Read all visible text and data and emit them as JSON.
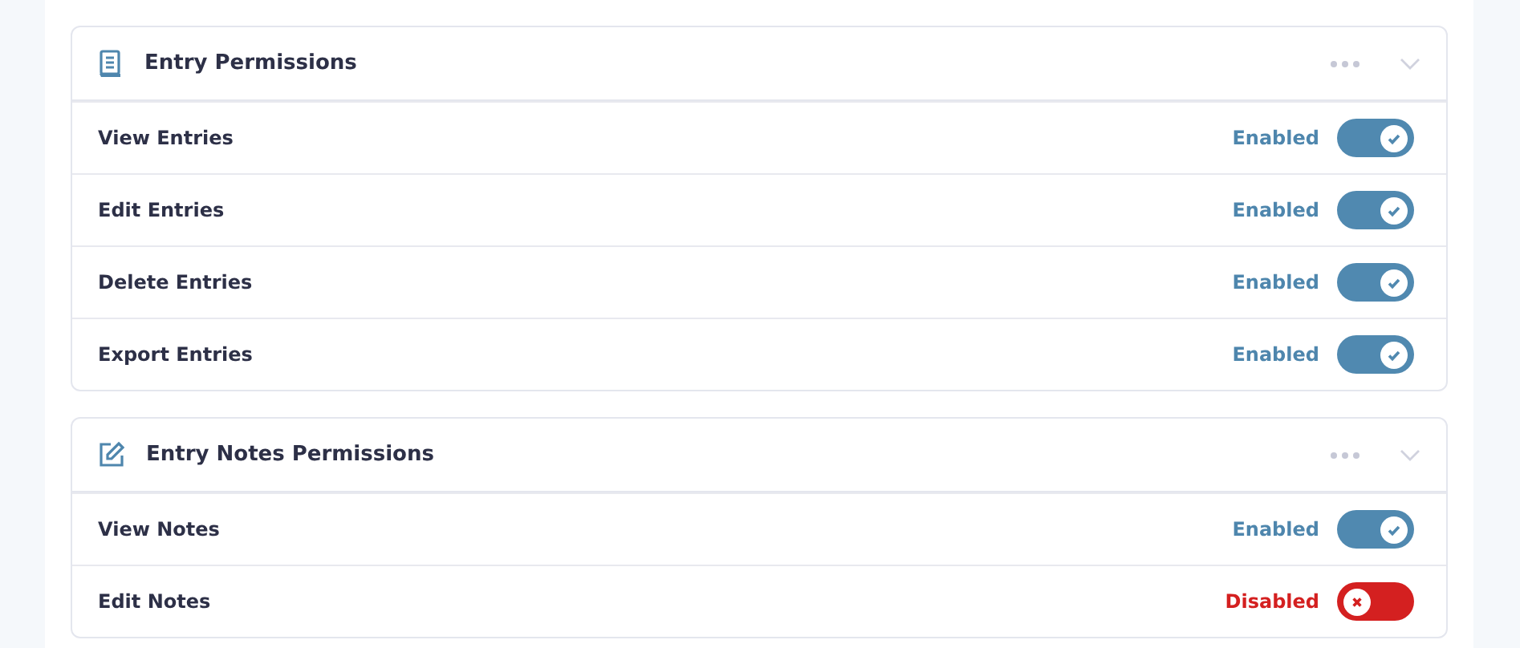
{
  "sections": [
    {
      "title": "Entry Permissions",
      "kind": "document",
      "permissions": [
        {
          "label": "View Entries",
          "status": "Enabled",
          "on": true
        },
        {
          "label": "Edit Entries",
          "status": "Enabled",
          "on": true
        },
        {
          "label": "Delete Entries",
          "status": "Enabled",
          "on": true
        },
        {
          "label": "Export Entries",
          "status": "Enabled",
          "on": true
        }
      ]
    },
    {
      "title": "Entry Notes Permissions",
      "kind": "edit",
      "permissions": [
        {
          "label": "View Notes",
          "status": "Enabled",
          "on": true
        },
        {
          "label": "Edit Notes",
          "status": "Disabled",
          "on": false
        }
      ]
    }
  ]
}
